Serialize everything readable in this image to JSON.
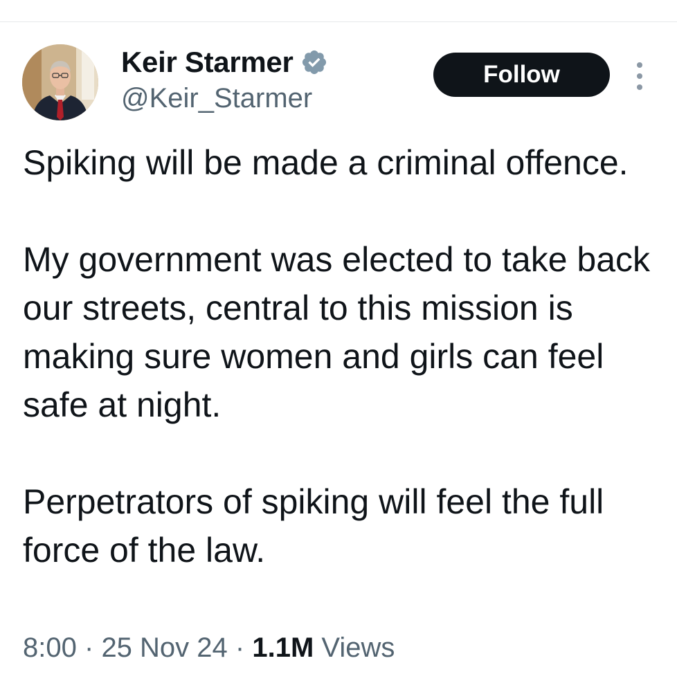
{
  "author": {
    "display_name": "Keir Starmer",
    "handle": "@Keir_Starmer",
    "verified_icon": "verified-badge-icon",
    "verified_color": "#829aab"
  },
  "actions": {
    "follow_label": "Follow",
    "more_icon": "more-vertical-icon"
  },
  "tweet": {
    "paragraphs": [
      "Spiking will be made a criminal offence.",
      "My government was elected to take back our streets, central to this mission is making sure women and girls can feel safe at night.",
      "Perpetrators of spiking will feel the full force of the law."
    ]
  },
  "meta": {
    "time": "8:00",
    "separator": "·",
    "date": "25 Nov 24",
    "views_count": "1.1M",
    "views_label": "Views"
  },
  "colors": {
    "text_primary": "#0f1419",
    "text_secondary": "#536471",
    "button_bg": "#0f1419",
    "button_text": "#ffffff"
  }
}
